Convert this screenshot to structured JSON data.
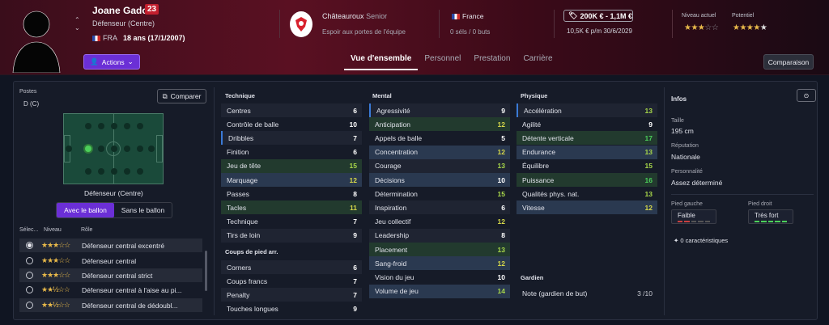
{
  "player": {
    "name": "Joane Gadou",
    "number": "23",
    "position": "Défenseur (Centre)",
    "nationality": "FRA",
    "age_text": "18 ans (17/1/2007)"
  },
  "actions_label": "Actions",
  "club": {
    "name": "Châteauroux",
    "level": "Senior",
    "status": "Espoir aux portes de l'équipe"
  },
  "country": {
    "name": "France",
    "selections": "0 séls / 0 buts"
  },
  "value": {
    "range": "200K € - 1,1M €",
    "wage": "10,5K € p/m  30/6/2029"
  },
  "ratings": {
    "current_label": "Niveau actuel",
    "potential_label": "Potentiel",
    "current_stars": "★★★☆☆",
    "potential_stars": "★★★★★"
  },
  "tabs": [
    "Vue d'ensemble",
    "Personnel",
    "Prestation",
    "Carrière"
  ],
  "compare_top_label": "Comparaison",
  "positions": {
    "label": "Postes",
    "value": "D (C)",
    "compare_label": "Comparer",
    "role_name": "Défenseur (Centre)"
  },
  "toggle": {
    "with_ball": "Avec le ballon",
    "without_ball": "Sans le ballon"
  },
  "role_list": {
    "headers": {
      "select": "Sélec...",
      "level": "Niveau",
      "role": "Rôle"
    },
    "rows": [
      {
        "stars": "★★★☆☆",
        "name": "Défenseur central excentré"
      },
      {
        "stars": "★★★☆☆",
        "name": "Défenseur central"
      },
      {
        "stars": "★★★☆☆",
        "name": "Défenseur central strict"
      },
      {
        "stars": "★★½☆☆",
        "name": "Défenseur central à l'aise au pi..."
      },
      {
        "stars": "★★½☆☆",
        "name": "Défenseur central de dédoubl..."
      }
    ]
  },
  "technique": {
    "title": "Technique",
    "attrs": [
      {
        "name": "Centres",
        "value": "6"
      },
      {
        "name": "Contrôle de balle",
        "value": "10"
      },
      {
        "name": "Dribbles",
        "value": "7"
      },
      {
        "name": "Finition",
        "value": "6"
      },
      {
        "name": "Jeu de tête",
        "value": "15"
      },
      {
        "name": "Marquage",
        "value": "12"
      },
      {
        "name": "Passes",
        "value": "8"
      },
      {
        "name": "Tacles",
        "value": "11"
      },
      {
        "name": "Technique",
        "value": "7"
      },
      {
        "name": "Tirs de loin",
        "value": "9"
      }
    ]
  },
  "set_pieces": {
    "title": "Coups de pied arr.",
    "attrs": [
      {
        "name": "Corners",
        "value": "6"
      },
      {
        "name": "Coups francs",
        "value": "7"
      },
      {
        "name": "Penalty",
        "value": "7"
      },
      {
        "name": "Touches longues",
        "value": "9"
      }
    ]
  },
  "mental": {
    "title": "Mental",
    "attrs": [
      {
        "name": "Agressivité",
        "value": "9"
      },
      {
        "name": "Anticipation",
        "value": "12"
      },
      {
        "name": "Appels de balle",
        "value": "5"
      },
      {
        "name": "Concentration",
        "value": "12"
      },
      {
        "name": "Courage",
        "value": "13"
      },
      {
        "name": "Décisions",
        "value": "10"
      },
      {
        "name": "Détermination",
        "value": "15"
      },
      {
        "name": "Inspiration",
        "value": "6"
      },
      {
        "name": "Jeu collectif",
        "value": "12"
      },
      {
        "name": "Leadership",
        "value": "8"
      },
      {
        "name": "Placement",
        "value": "13"
      },
      {
        "name": "Sang-froid",
        "value": "12"
      },
      {
        "name": "Vision du jeu",
        "value": "10"
      },
      {
        "name": "Volume de jeu",
        "value": "14"
      }
    ]
  },
  "physical": {
    "title": "Physique",
    "attrs": [
      {
        "name": "Accélération",
        "value": "13"
      },
      {
        "name": "Agilité",
        "value": "9"
      },
      {
        "name": "Détente verticale",
        "value": "17"
      },
      {
        "name": "Endurance",
        "value": "13"
      },
      {
        "name": "Équilibre",
        "value": "15"
      },
      {
        "name": "Puissance",
        "value": "16"
      },
      {
        "name": "Qualités phys. nat.",
        "value": "13"
      },
      {
        "name": "Vitesse",
        "value": "12"
      }
    ]
  },
  "goalkeeper": {
    "title": "Gardien",
    "attr": "Note (gardien de but)",
    "value": "3 /10"
  },
  "infos": {
    "title": "Infos",
    "height_label": "Taille",
    "height": "195 cm",
    "reputation_label": "Réputation",
    "reputation": "Nationale",
    "personality_label": "Personnalité",
    "personality": "Assez déterminé",
    "left_foot_label": "Pied gauche",
    "left_foot": "Faible",
    "right_foot_label": "Pied droit",
    "right_foot": "Très fort",
    "traits": "0 caractéristiques"
  }
}
